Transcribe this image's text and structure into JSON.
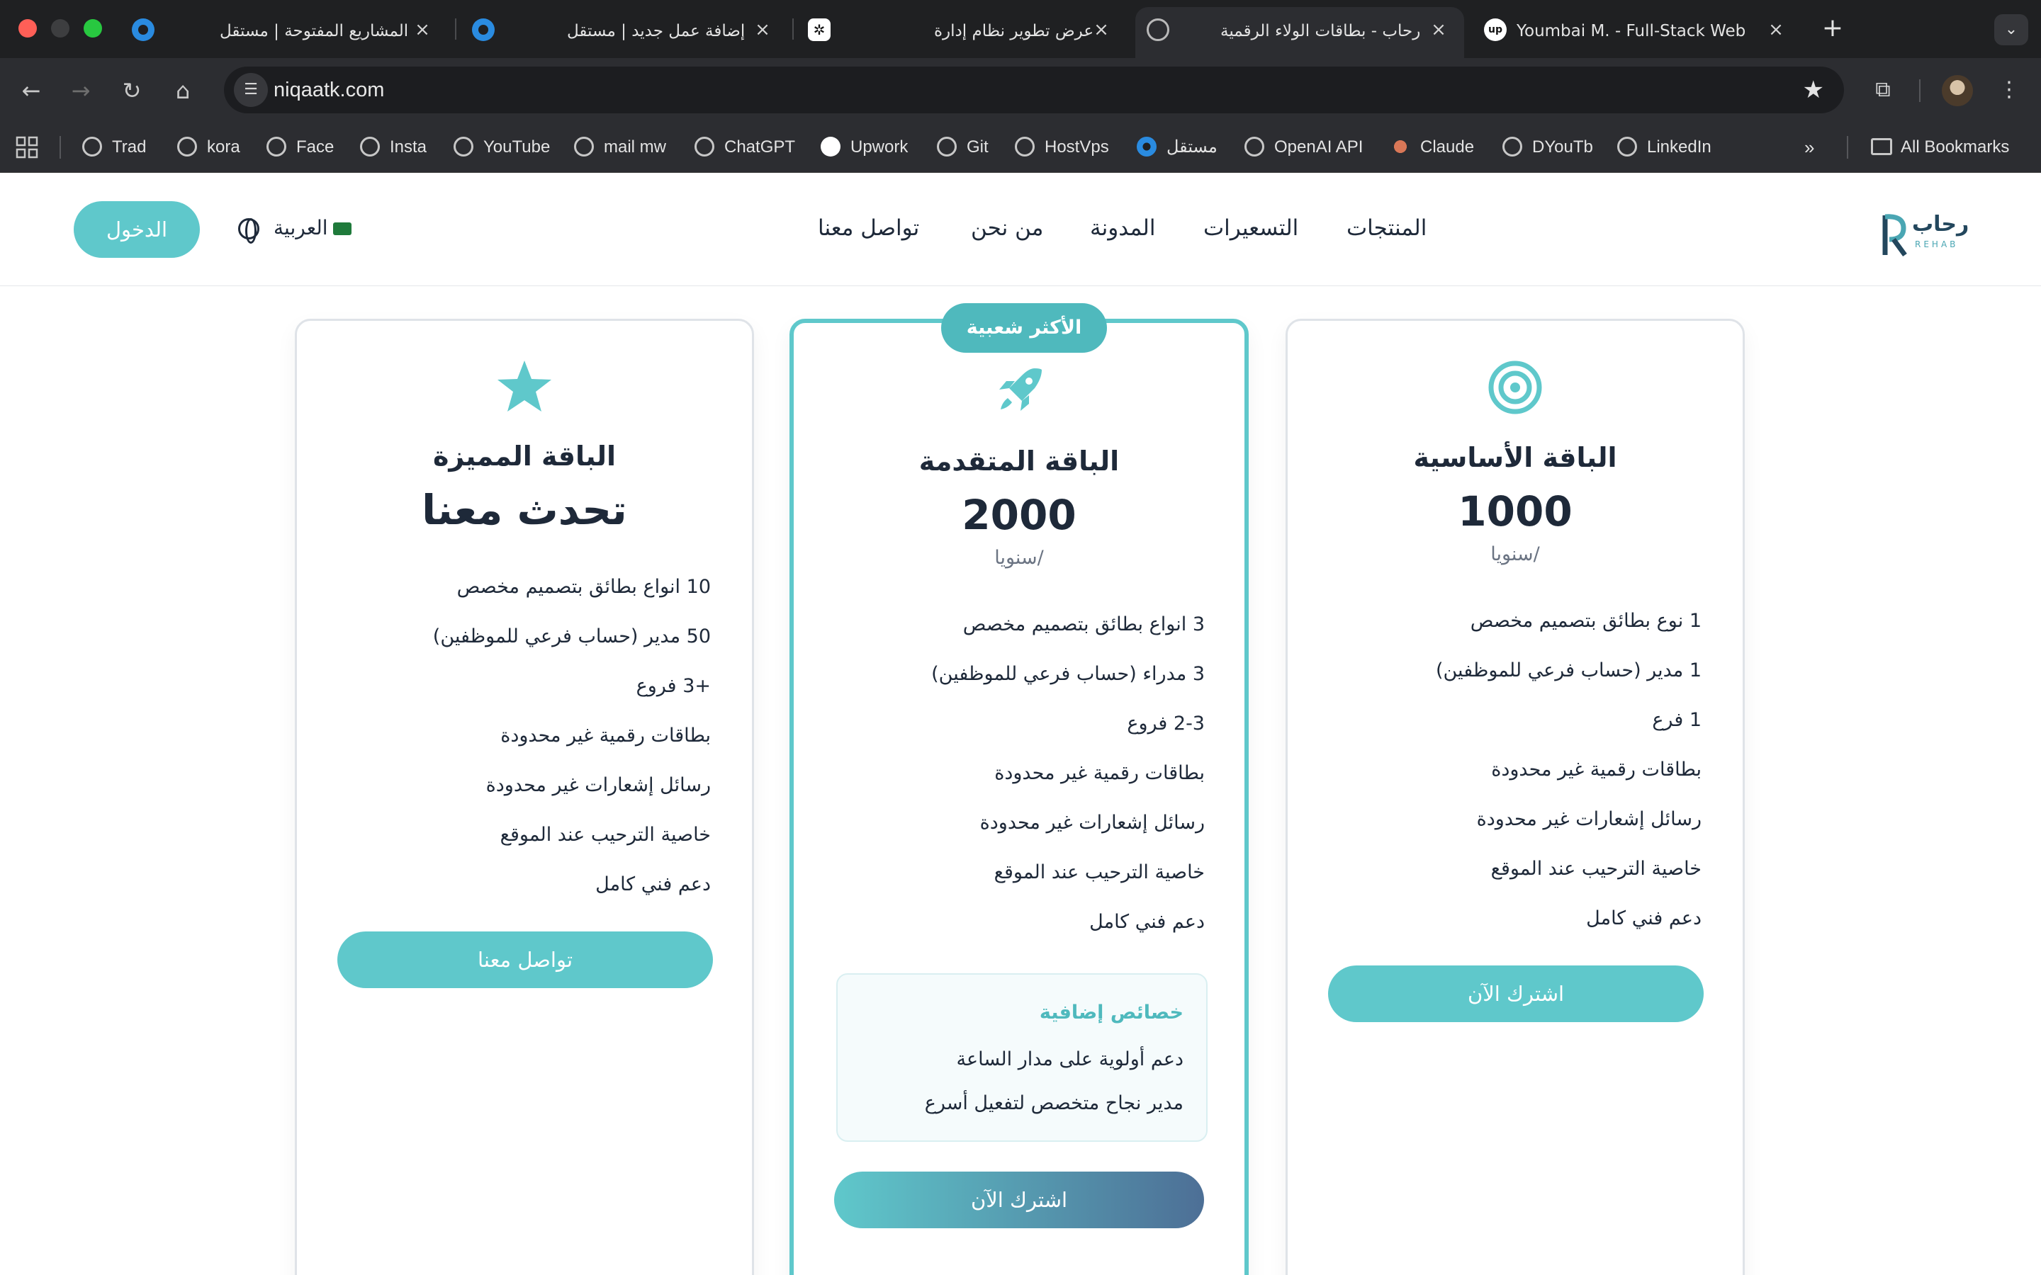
{
  "browser": {
    "tabs": [
      {
        "title": "المشاريع المفتوحة | مستقل",
        "icon": "mostaql-icon"
      },
      {
        "title": "إضافة عمل جديد | مستقل",
        "icon": "mostaql-icon"
      },
      {
        "title": "عرض تطوير نظام إدارة",
        "icon": "chatgpt-icon"
      },
      {
        "title": "رحاب - بطاقات الولاء الرقمية",
        "icon": "globe-icon"
      },
      {
        "title": "Youmbai M. - Full-Stack Web",
        "icon": "upwork-icon"
      }
    ],
    "url": "niqaatk.com",
    "bookmarks": [
      "Trad",
      "kora",
      "Face",
      "Insta",
      "YouTube",
      "mail mw",
      "ChatGPT",
      "Upwork",
      "Git",
      "HostVps",
      "مستقل",
      "OpenAI API",
      "Claude",
      "DYouTb",
      "LinkedIn"
    ],
    "all_bookmarks": "All Bookmarks"
  },
  "site": {
    "logo_text": "رحاب",
    "logo_sub": "REHAB",
    "nav": [
      "المنتجات",
      "التسعيرات",
      "المدونة",
      "من نحن",
      "تواصل معنا"
    ],
    "language": "العربية",
    "login": "الدخول",
    "accent_color": "#5fc8cb",
    "plans": [
      {
        "name": "الباقة الأساسية",
        "price": "1000",
        "period": "/سنويا",
        "icon": "target-icon",
        "features": [
          "1 نوع بطائق بتصميم مخصص",
          "1 مدير (حساب فرعي للموظفين)",
          "1 فرع",
          "بطاقات رقمية غير محدودة",
          "رسائل إشعارات غير محدودة",
          "خاصية الترحيب عند الموقع",
          "دعم فني كامل"
        ],
        "cta": "اشترك الآن"
      },
      {
        "name": "الباقة المتقدمة",
        "badge": "الأكثر شعبية",
        "price": "2000",
        "period": "/سنويا",
        "icon": "rocket-icon",
        "features": [
          "3 انواع بطائق بتصميم مخصص",
          "3 مدراء (حساب فرعي للموظفين)",
          "2-3 فروع",
          "بطاقات رقمية غير محدودة",
          "رسائل إشعارات غير محدودة",
          "خاصية الترحيب عند الموقع",
          "دعم فني كامل"
        ],
        "extras_title": "خصائص إضافية",
        "extras": [
          "دعم أولوية على مدار الساعة",
          "مدير نجاح متخصص لتفعيل أسرع"
        ],
        "cta": "اشترك الآن"
      },
      {
        "name": "الباقة المميزة",
        "price": "تحدث معنا",
        "icon": "star-icon",
        "features": [
          "10 انواع بطائق بتصميم مخصص",
          "50 مدير (حساب فرعي للموظفين)",
          "+3 فروع",
          "بطاقات رقمية غير محدودة",
          "رسائل إشعارات غير محدودة",
          "خاصية الترحيب عند الموقع",
          "دعم فني كامل"
        ],
        "cta": "تواصل معنا"
      }
    ]
  }
}
